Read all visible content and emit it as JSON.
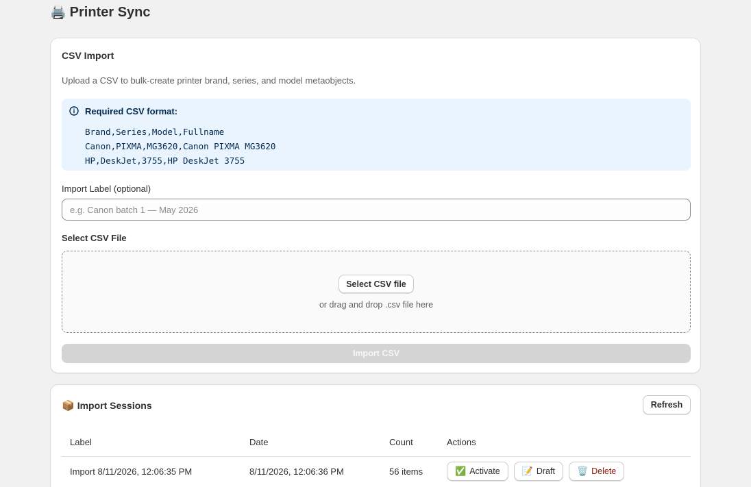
{
  "app": {
    "title": "Printer Sync",
    "title_icon": "🖨️"
  },
  "csv_import": {
    "heading": "CSV Import",
    "description": "Upload a CSV to bulk-create printer brand, series, and model metaobjects.",
    "info_title": "Required CSV format:",
    "code_lines": [
      "Brand,Series,Model,Fullname",
      "Canon,PIXMA,MG3620,Canon PIXMA MG3620",
      "HP,DeskJet,3755,HP DeskJet 3755"
    ],
    "label_field": {
      "label": "Import Label (optional)",
      "placeholder": "e.g. Canon batch 1 — May 2026",
      "value": ""
    },
    "file_field": {
      "label": "Select CSV File",
      "button": "Select CSV file",
      "hint": "or drag and drop .csv file here"
    },
    "import_button": "Import CSV"
  },
  "sessions": {
    "heading": "Import Sessions",
    "heading_icon": "📦",
    "refresh_button": "Refresh",
    "columns": [
      "Label",
      "Date",
      "Count",
      "Actions"
    ],
    "rows": [
      {
        "label": "Import 8/11/2026, 12:06:35 PM",
        "date": "8/11/2026, 12:06:36 PM",
        "count": "56 items",
        "activate": {
          "icon": "✅",
          "label": "Activate"
        },
        "draft": {
          "icon": "📝",
          "label": "Draft"
        },
        "delete": {
          "icon": "🗑️",
          "label": "Delete"
        }
      }
    ]
  },
  "colors": {
    "background": "#f1f1f1",
    "info_banner": "#eaf4ff",
    "info_text": "#00294d",
    "disabled_button": "#d4d4d4",
    "danger_text": "#8e1f0b"
  }
}
